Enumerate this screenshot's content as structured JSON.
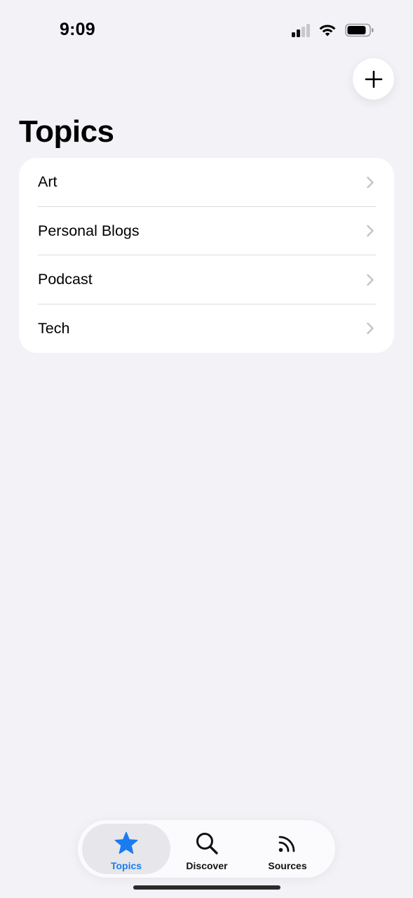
{
  "status_bar": {
    "time": "9:09"
  },
  "header": {
    "add_button_icon": "plus-icon",
    "title": "Topics"
  },
  "topics": [
    {
      "label": "Art"
    },
    {
      "label": "Personal Blogs"
    },
    {
      "label": "Podcast"
    },
    {
      "label": "Tech"
    }
  ],
  "tab_bar": {
    "tabs": [
      {
        "label": "Topics",
        "icon": "star-icon",
        "active": true
      },
      {
        "label": "Discover",
        "icon": "search-icon",
        "active": false
      },
      {
        "label": "Sources",
        "icon": "rss-icon",
        "active": false
      }
    ]
  },
  "colors": {
    "background": "#f2f2f7",
    "accent": "#1a7cf0",
    "card": "#ffffff",
    "chevron": "#c4c4c7"
  }
}
